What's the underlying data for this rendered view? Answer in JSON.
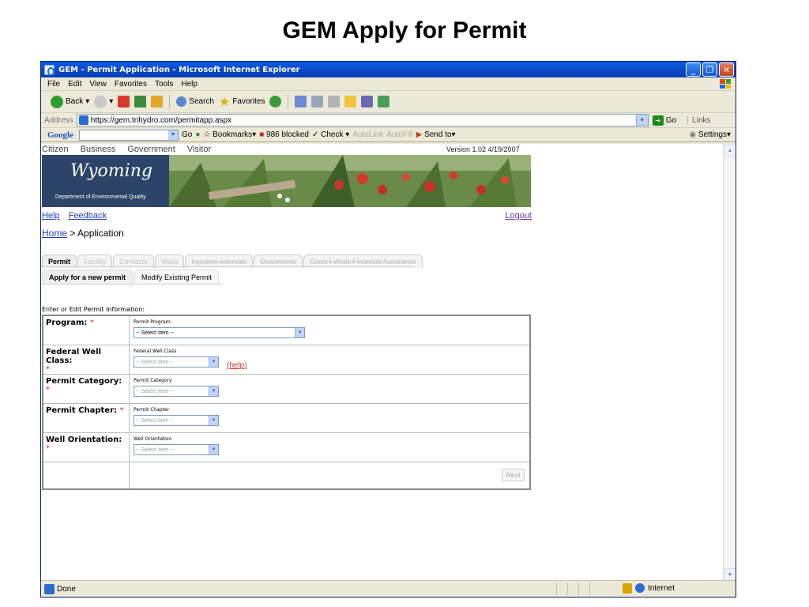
{
  "slide": {
    "title": "GEM Apply for Permit"
  },
  "window": {
    "title": "GEM - Permit Application - Microsoft Internet Explorer"
  },
  "menu": [
    "File",
    "Edit",
    "View",
    "Favorites",
    "Tools",
    "Help"
  ],
  "toolbar": {
    "back": "Back",
    "search": "Search",
    "favorites": "Favorites"
  },
  "address": {
    "label": "Address",
    "url": "https://gem.trihydro.com/permitapp.aspx",
    "go": "Go",
    "links": "Links"
  },
  "googlebar": {
    "logo": "Google",
    "go": "Go",
    "bookmarks": "Bookmarks",
    "blocked": "986 blocked",
    "check": "Check",
    "autolink": "AutoLink",
    "autofill": "AutoFill",
    "send_to": "Send to",
    "settings": "Settings"
  },
  "site": {
    "nav": [
      "Citizen",
      "Business",
      "Government",
      "Visitor"
    ],
    "version": "Version 1.02 4/19/2007",
    "logo_script": "Wyoming",
    "dept": "Department of Environmental Quality",
    "help": "Help",
    "feedback": "Feedback",
    "logout": "Logout",
    "breadcrumb_home": "Home",
    "breadcrumb_sep": " > ",
    "breadcrumb_current": "Application"
  },
  "tabs": [
    "Permit",
    "Facility",
    "Contacts",
    "Wells",
    "Injection Intervals",
    "Documents",
    "Class I Wells Financial Assurance"
  ],
  "subtabs": [
    "Apply for a new permit",
    "Modify Existing Permit"
  ],
  "form": {
    "caption": "Enter or Edit Permit Information:",
    "rows": [
      {
        "label": "Program:",
        "caption": "Permit Program:",
        "value": "-- Select Item --"
      },
      {
        "label": "Federal Well Class:",
        "caption": "Federal Well Class",
        "value": "-- Select Item --",
        "help": "(help)"
      },
      {
        "label": "Permit Category:",
        "caption": "Permit Category",
        "value": "-- Select Item --"
      },
      {
        "label": "Permit Chapter:",
        "caption": "Permit Chapter",
        "value": "-- Select Item --"
      },
      {
        "label": "Well Orientation:",
        "caption": "Well Orientation",
        "value": "-- Select Item --"
      }
    ],
    "required_mark": "*",
    "next": "Next"
  },
  "status": {
    "text": "Done",
    "zone": "Internet"
  }
}
